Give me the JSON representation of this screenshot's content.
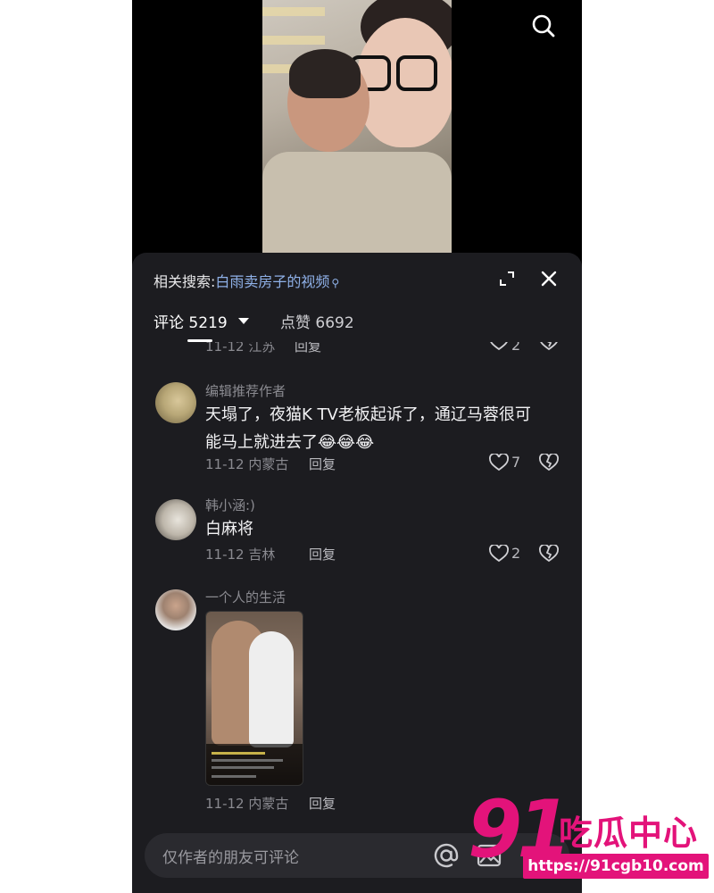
{
  "sheet": {
    "related_prefix": "相关搜索:",
    "related_query": "白雨卖房子的视频",
    "tabs": {
      "comments": "评论 5219",
      "likes": "点赞 6692"
    }
  },
  "comments": [
    {
      "meta": "11-12 江苏",
      "reply": "回复",
      "likes": "2"
    },
    {
      "author": "编辑推荐作者",
      "text_line1": "天塌了，夜猫K TV老板起诉了，通辽马蓉很可",
      "text_line2": "能马上就进去了😂😂😂",
      "meta": "11-12 内蒙古",
      "reply": "回复",
      "likes": "7"
    },
    {
      "author": "韩小涵:)",
      "text": "白麻将",
      "meta": "11-12 吉林",
      "reply": "回复",
      "likes": "2"
    },
    {
      "author": "一个人的生活",
      "meta": "11-12 内蒙古",
      "reply": "回复"
    }
  ],
  "input": {
    "placeholder": "仅作者的朋友可评论"
  },
  "watermark": {
    "brand_num": "91",
    "brand_cn": "吃瓜中心",
    "url": "https://91cgb10.com"
  },
  "colors": {
    "sheet_bg": "#1c1c20",
    "link": "#8fb1e8",
    "brand": "#e3137a"
  }
}
